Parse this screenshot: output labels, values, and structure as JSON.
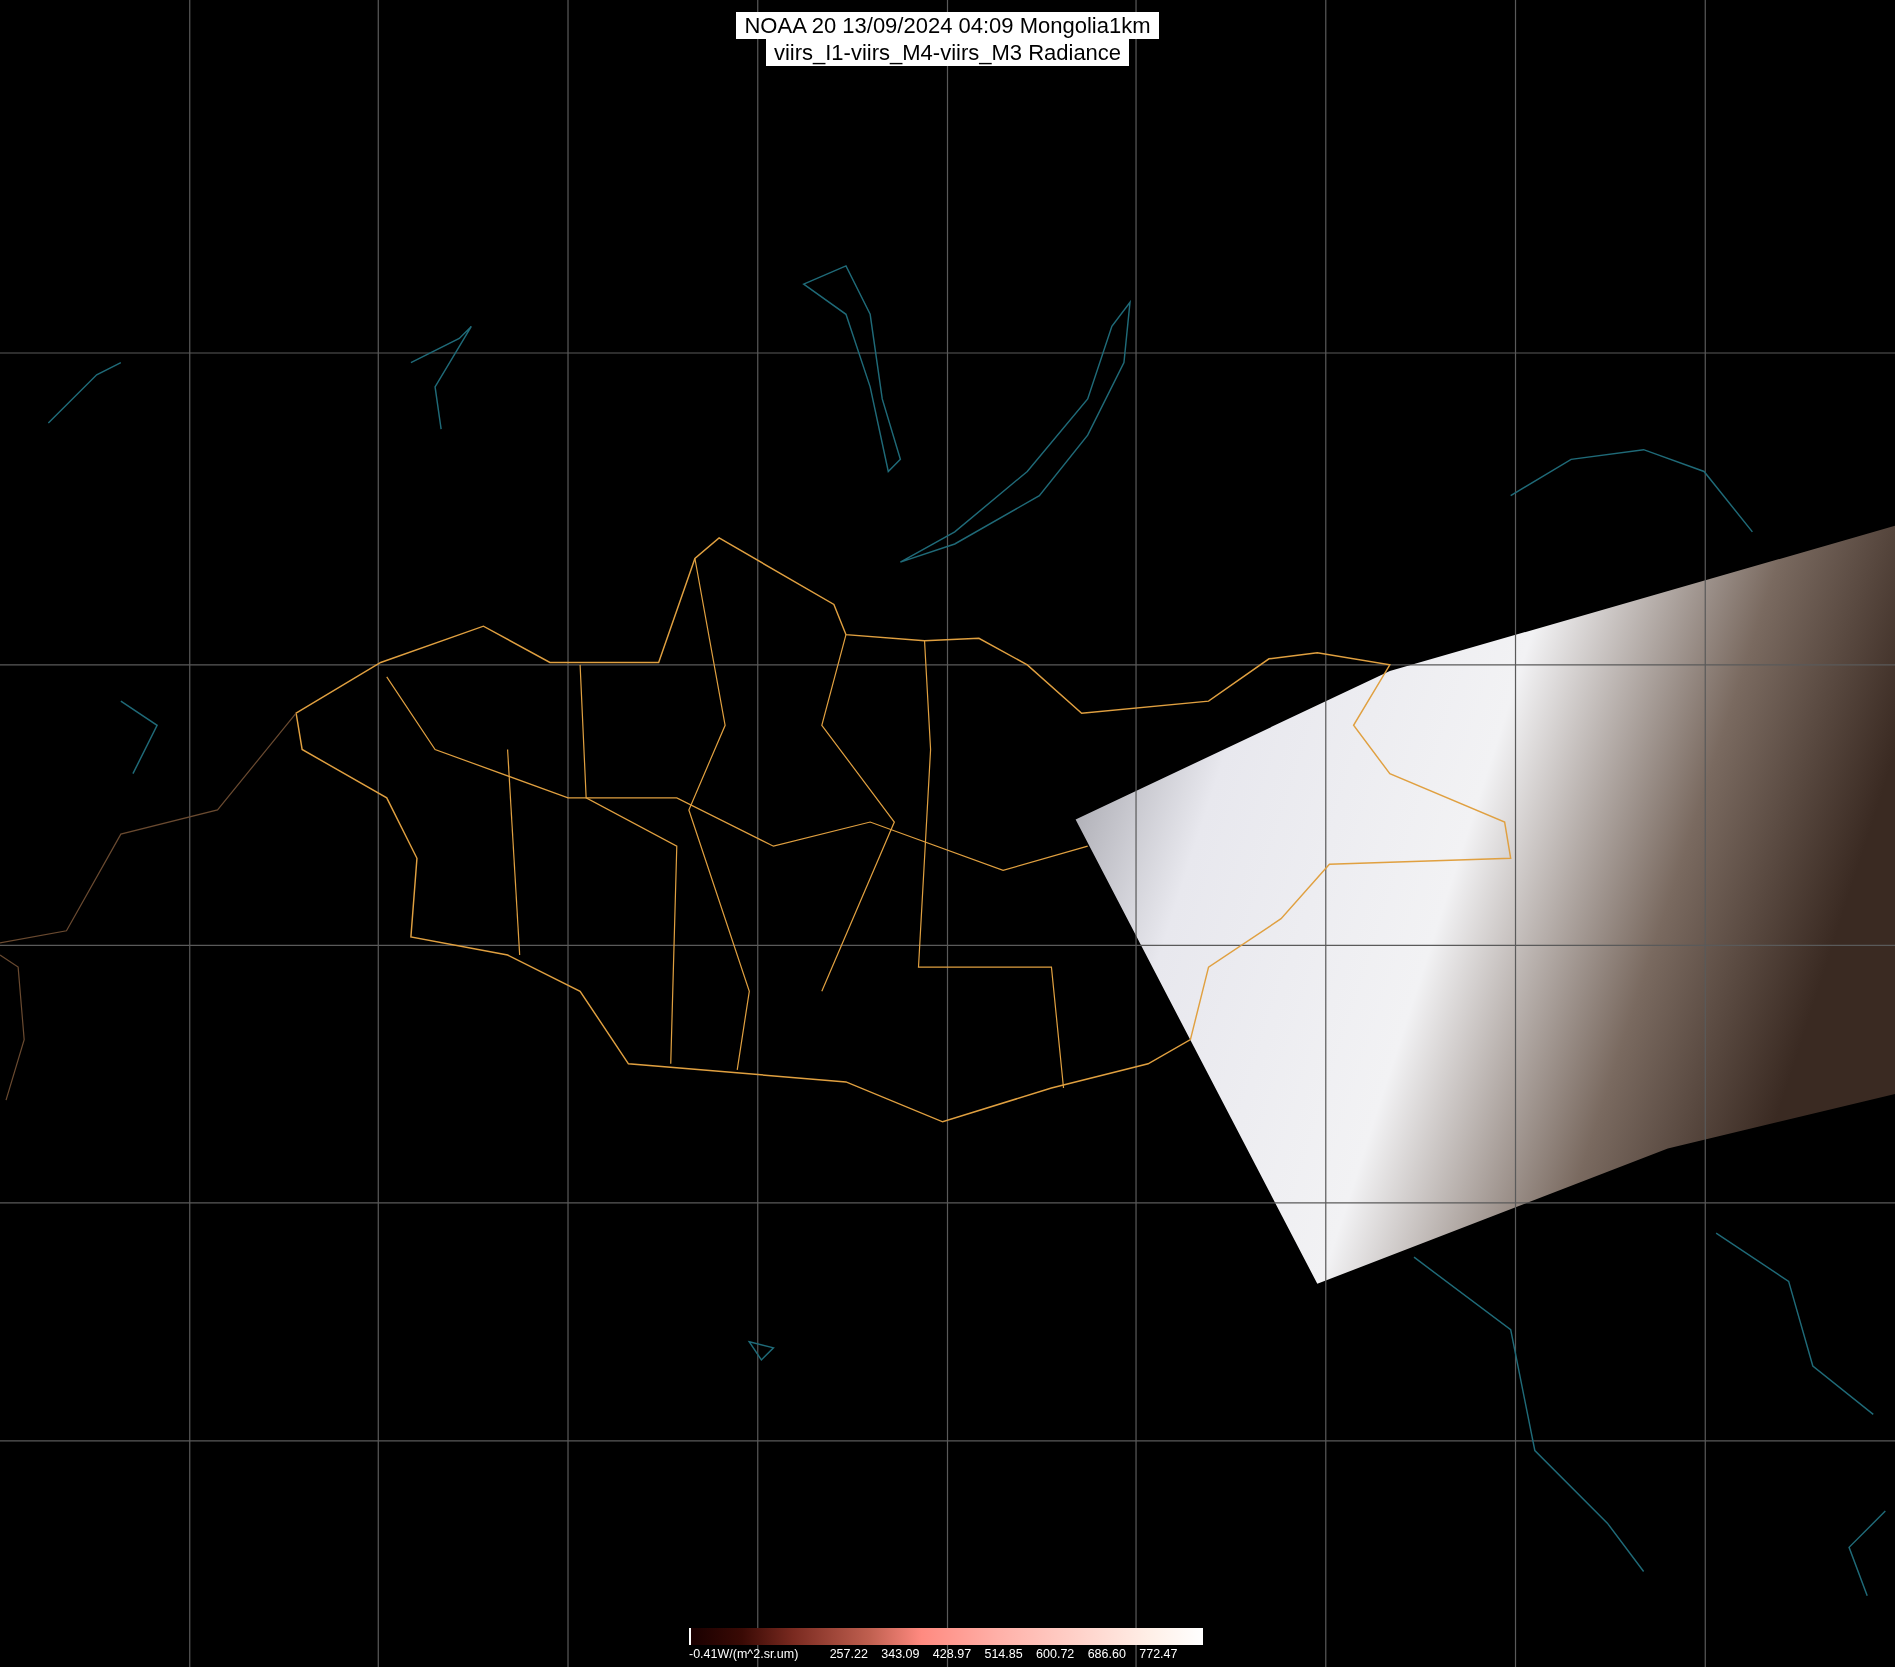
{
  "title": {
    "lines": [
      "NOAA 20 13/09/2024 04:09 Mongolia1km",
      "viirs_I1-viirs_M4-viirs_M3 Radiance"
    ]
  },
  "colorbar": {
    "labels": [
      "-0.41W/(m^2.sr.um)",
      "257.22",
      "343.09",
      "428.97",
      "514.85",
      "600.72",
      "686.60",
      "772.47"
    ]
  }
}
